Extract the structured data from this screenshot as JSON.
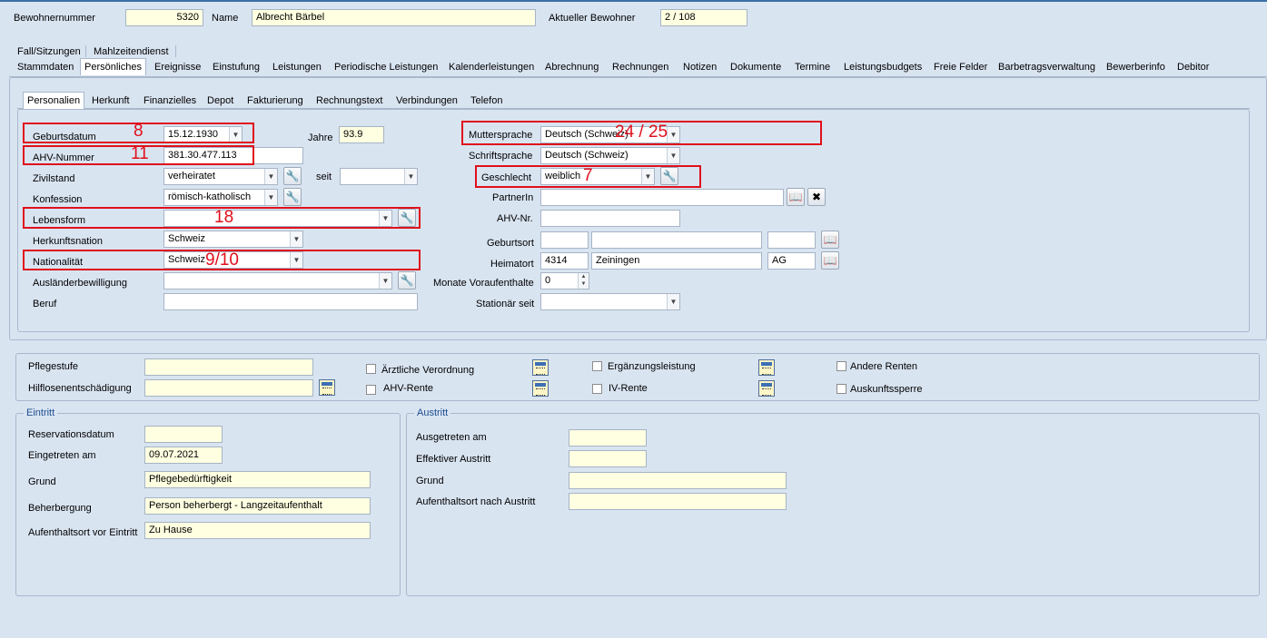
{
  "header": {
    "bewohnernummer_label": "Bewohnernummer",
    "bewohnernummer_value": "5320",
    "name_label": "Name",
    "name_value": "Albrecht Bärbel",
    "aktueller_label": "Aktueller Bewohner",
    "aktueller_value": "2 / 108"
  },
  "tabs_row1": [
    "Fall/Sitzungen",
    "Mahlzeitendienst"
  ],
  "tabs_row2": [
    "Stammdaten",
    "Persönliches",
    "Ereignisse",
    "Einstufung",
    "Leistungen",
    "Periodische Leistungen",
    "Kalenderleistungen",
    "Abrechnung",
    "Rechnungen",
    "Notizen",
    "Dokumente",
    "Termine",
    "Leistungsbudgets",
    "Freie Felder",
    "Barbetragsverwaltung",
    "Bewerberinfo",
    "Debitor"
  ],
  "subtabs": [
    "Personalien",
    "Herkunft",
    "Finanzielles",
    "Depot",
    "Fakturierung",
    "Rechnungstext",
    "Verbindungen",
    "Telefon"
  ],
  "personalien": {
    "geburtsdatum_label": "Geburtsdatum",
    "geburtsdatum_value": "15.12.1930",
    "jahre_label": "Jahre",
    "jahre_value": "93.9",
    "ahv_label": "AHV-Nummer",
    "ahv_value": "381.30.477.113",
    "zivilstand_label": "Zivilstand",
    "zivilstand_value": "verheiratet",
    "seit_label": "seit",
    "seit_value": "",
    "konfession_label": "Konfession",
    "konfession_value": "römisch-katholisch",
    "lebensform_label": "Lebensform",
    "lebensform_value": "",
    "herkunftsnation_label": "Herkunftsnation",
    "herkunftsnation_value": "Schweiz",
    "nationalitaet_label": "Nationalität",
    "nationalitaet_value": "Schweiz",
    "auslaender_label": "Ausländerbewilligung",
    "auslaender_value": "",
    "beruf_label": "Beruf",
    "beruf_value": "",
    "muttersprache_label": "Muttersprache",
    "muttersprache_value": "Deutsch (Schweiz)",
    "schriftsprache_label": "Schriftsprache",
    "schriftsprache_value": "Deutsch (Schweiz)",
    "geschlecht_label": "Geschlecht",
    "geschlecht_value": "weiblich",
    "partner_label": "PartnerIn",
    "partner_value": "",
    "ahvnr_label": "AHV-Nr.",
    "ahvnr_value": "",
    "geburtsort_label": "Geburtsort",
    "geburtsort_plz": "",
    "geburtsort_ort": "",
    "geburtsort_kanton": "",
    "heimatort_label": "Heimatort",
    "heimatort_plz": "4314",
    "heimatort_ort": "Zeiningen",
    "heimatort_kanton": "AG",
    "monate_label": "Monate Voraufenthalte",
    "monate_value": "0",
    "stationaer_label": "Stationär seit",
    "stationaer_value": ""
  },
  "annotations": {
    "geburtsdatum": "8",
    "ahv": "11",
    "lebensform": "18",
    "nationalitaet": "9/10",
    "muttersprache": "24 / 25",
    "geschlecht": "7"
  },
  "pflege": {
    "pflegestufe_label": "Pflegestufe",
    "pflegestufe_value": "",
    "hilflosen_label": "Hilflosenentschädigung",
    "hilflosen_value": "",
    "aerztliche_label": "Ärztliche Verordnung",
    "ahv_rente_label": "AHV-Rente",
    "ergaenzung_label": "Ergänzungsleistung",
    "iv_rente_label": "IV-Rente",
    "andere_renten_label": "Andere Renten",
    "auskunftssperre_label": "Auskunftssperre"
  },
  "eintritt": {
    "title": "Eintritt",
    "reservation_label": "Reservationsdatum",
    "reservation_value": "",
    "eingetreten_label": "Eingetreten am",
    "eingetreten_value": "09.07.2021",
    "grund_label": "Grund",
    "grund_value": "Pflegebedürftigkeit",
    "beherbergung_label": "Beherbergung",
    "beherbergung_value": "Person beherbergt - Langzeitaufenthalt",
    "aufenthalt_label": "Aufenthaltsort vor Eintritt",
    "aufenthalt_value": "Zu Hause"
  },
  "austritt": {
    "title": "Austritt",
    "ausgetreten_label": "Ausgetreten am",
    "ausgetreten_value": "",
    "effektiv_label": "Effektiver Austritt",
    "effektiv_value": "",
    "grund_label": "Grund",
    "grund_value": "",
    "aufenthalt_label": "Aufenthaltsort nach Austritt",
    "aufenthalt_value": ""
  },
  "colors": {
    "background": "#d9e4f1",
    "annotation": "#e0101c",
    "readonly_field": "#ffffe1"
  },
  "icons": {
    "edit": "wrench-icon",
    "lookup": "book-icon",
    "clear": "eraser-icon",
    "calendar": "calendar-icon"
  }
}
